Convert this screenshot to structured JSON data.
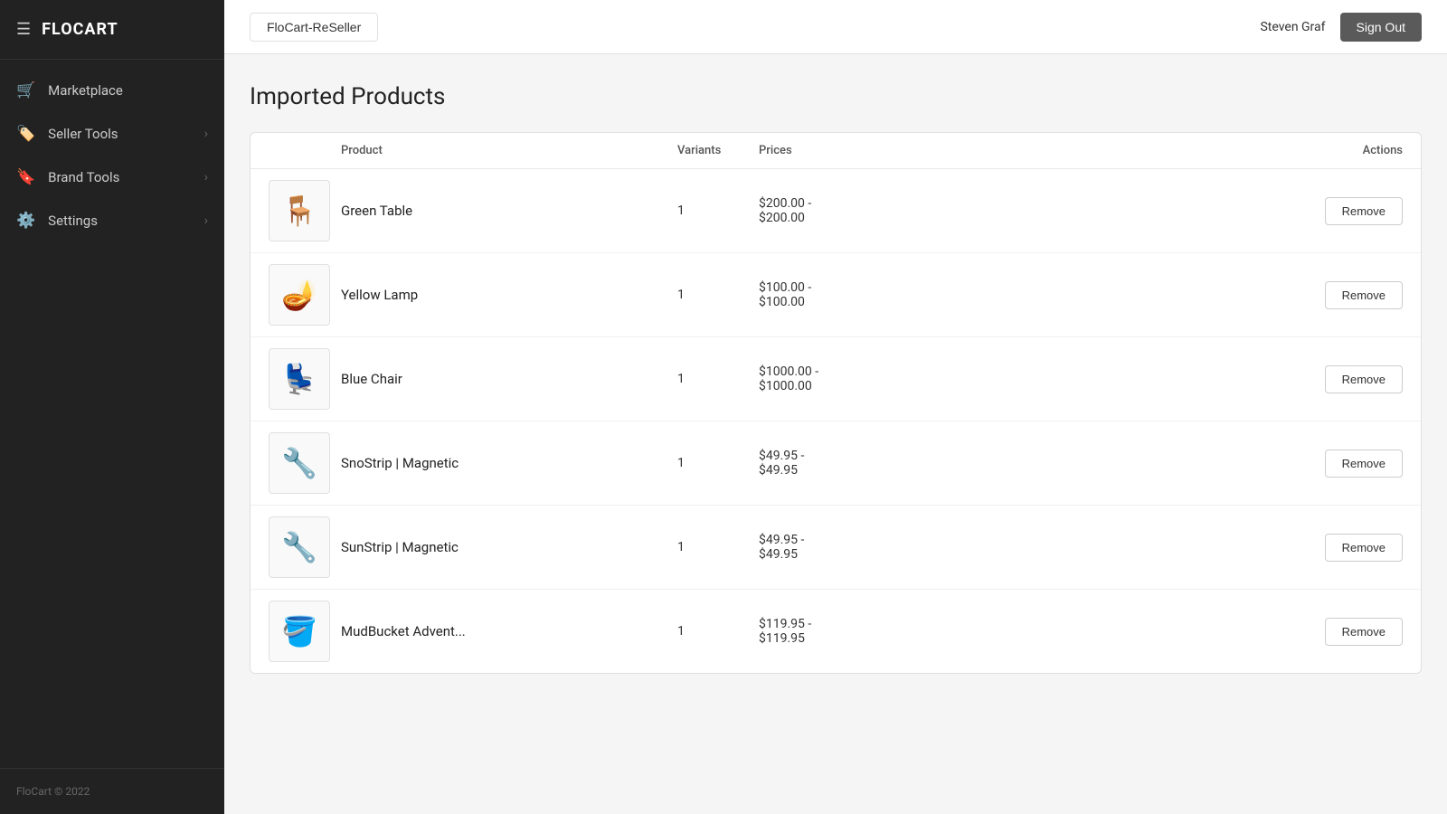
{
  "app": {
    "name": "FLOCART",
    "footer": "FloCart © 2022"
  },
  "header": {
    "tab_label": "FloCart-ReSeller",
    "username": "Steven Graf",
    "signout_label": "Sign Out"
  },
  "sidebar": {
    "items": [
      {
        "id": "marketplace",
        "label": "Marketplace",
        "icon": "🛒",
        "hasChevron": false
      },
      {
        "id": "seller-tools",
        "label": "Seller Tools",
        "icon": "🏷️",
        "hasChevron": true
      },
      {
        "id": "brand-tools",
        "label": "Brand Tools",
        "icon": "🔖",
        "hasChevron": true
      },
      {
        "id": "settings",
        "label": "Settings",
        "icon": "⚙️",
        "hasChevron": true
      }
    ]
  },
  "page": {
    "title": "Imported Products"
  },
  "table": {
    "columns": [
      "",
      "Product",
      "Variants",
      "Prices",
      "",
      "Actions"
    ],
    "rows": [
      {
        "id": 1,
        "name": "Green Table",
        "variants": "1",
        "price_range": "$200.00 -\n$200.00",
        "emoji": "🪑",
        "color": "#6bbf3c"
      },
      {
        "id": 2,
        "name": "Yellow Lamp",
        "variants": "1",
        "price_range": "$100.00 -\n$100.00",
        "emoji": "🪔",
        "color": "#e8c832"
      },
      {
        "id": 3,
        "name": "Blue Chair",
        "variants": "1",
        "price_range": "$1000.00 -\n$1000.00",
        "emoji": "💺",
        "color": "#3a6ad4"
      },
      {
        "id": 4,
        "name": "SnoStrip | Magnetic",
        "variants": "1",
        "price_range": "$49.95 -\n$49.95",
        "emoji": "🔧",
        "color": "#333"
      },
      {
        "id": 5,
        "name": "SunStrip | Magnetic",
        "variants": "1",
        "price_range": "$49.95 -\n$49.95",
        "emoji": "🔧",
        "color": "#444"
      },
      {
        "id": 6,
        "name": "MudBucket Advent...",
        "variants": "1",
        "price_range": "$119.95 -\n$119.95",
        "emoji": "🪣",
        "color": "#222"
      }
    ],
    "remove_label": "Remove"
  }
}
